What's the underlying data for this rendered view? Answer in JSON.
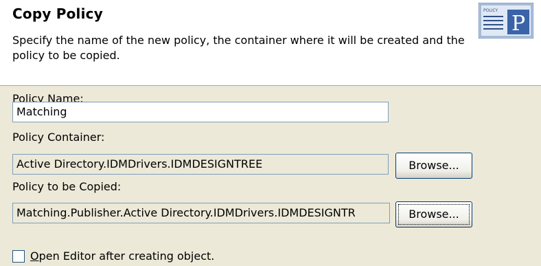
{
  "header": {
    "title": "Copy Policy",
    "description": "Specify the name of the new policy, the container where it will be created and the policy to be copied.",
    "icon": "policy-document-icon",
    "icon_text": "POLICY",
    "icon_letter": "P"
  },
  "form": {
    "policy_name_label": "Policy Name:",
    "policy_name_value": "Matching",
    "policy_container_label": "Policy Container:",
    "policy_container_value": "Active Directory.IDMDrivers.IDMDESIGNTREE",
    "policy_to_copy_label": "Policy to be Copied:",
    "policy_to_copy_value": "Matching.Publisher.Active Directory.IDMDrivers.IDMDESIGNTR",
    "browse_label": "Browse...",
    "open_editor_mnemonic": "O",
    "open_editor_rest": "pen Editor after creating object.",
    "open_editor_checked": false
  }
}
